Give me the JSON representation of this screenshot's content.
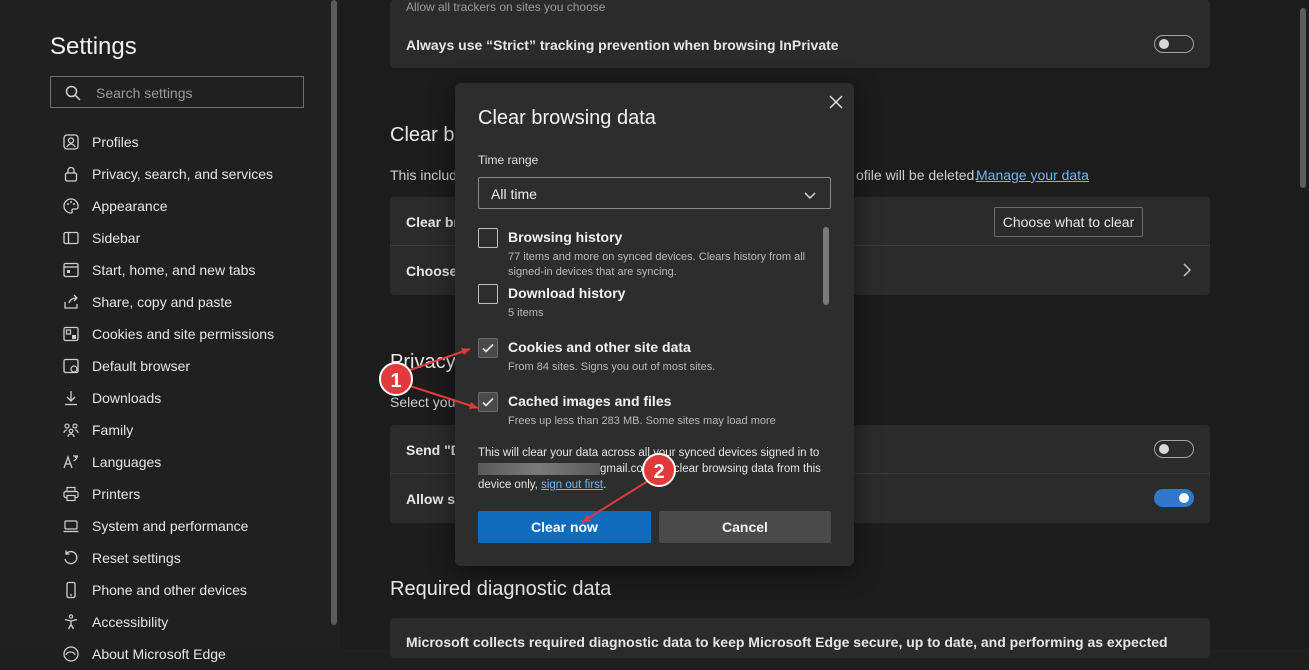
{
  "sidebar": {
    "title": "Settings",
    "search_placeholder": "Search settings",
    "items": [
      {
        "label": "Profiles",
        "icon": "profile-icon"
      },
      {
        "label": "Privacy, search, and services",
        "icon": "lock-icon"
      },
      {
        "label": "Appearance",
        "icon": "palette-icon"
      },
      {
        "label": "Sidebar",
        "icon": "sidebar-icon"
      },
      {
        "label": "Start, home, and new tabs",
        "icon": "home-tab-icon"
      },
      {
        "label": "Share, copy and paste",
        "icon": "share-icon"
      },
      {
        "label": "Cookies and site permissions",
        "icon": "cookie-icon"
      },
      {
        "label": "Default browser",
        "icon": "browser-icon"
      },
      {
        "label": "Downloads",
        "icon": "download-icon"
      },
      {
        "label": "Family",
        "icon": "family-icon"
      },
      {
        "label": "Languages",
        "icon": "languages-icon"
      },
      {
        "label": "Printers",
        "icon": "printer-icon"
      },
      {
        "label": "System and performance",
        "icon": "laptop-icon"
      },
      {
        "label": "Reset settings",
        "icon": "reset-icon"
      },
      {
        "label": "Phone and other devices",
        "icon": "phone-icon"
      },
      {
        "label": "Accessibility",
        "icon": "accessibility-icon"
      },
      {
        "label": "About Microsoft Edge",
        "icon": "edge-icon"
      }
    ]
  },
  "main": {
    "top_card": {
      "subtext": "Allow all trackers on sites you choose",
      "inprivate_label": "Always use “Strict” tracking prevention when browsing InPrivate",
      "inprivate_toggle": "off"
    },
    "clear_section": {
      "heading": "Clear b",
      "desc_left": "This includ",
      "desc_right": "ofile will be deleted.",
      "manage_link": "Manage your data",
      "row1_label": "Clear br",
      "choose_button": "Choose what to clear",
      "row2_label": "Choose"
    },
    "privacy_section": {
      "heading": "Privacy",
      "select_text": "Select you",
      "row1_label": "Send \"D",
      "row1_toggle": "off",
      "row2_label": "Allow si",
      "row2_toggle": "on"
    },
    "diagnostic": {
      "heading": "Required diagnostic data",
      "text": "Microsoft collects required diagnostic data to keep Microsoft Edge secure, up to date, and performing as expected"
    }
  },
  "dialog": {
    "title": "Clear browsing data",
    "time_range_label": "Time range",
    "time_range_value": "All time",
    "options": [
      {
        "title": "Browsing history",
        "desc": "77 items and more on synced devices. Clears history from all signed-in devices that are syncing.",
        "checked": false
      },
      {
        "title": "Download history",
        "desc": "5 items",
        "checked": false
      },
      {
        "title": "Cookies and other site data",
        "desc": "From 84 sites. Signs you out of most sites.",
        "checked": true
      },
      {
        "title": "Cached images and files",
        "desc": "Frees up less than 283 MB. Some sites may load more",
        "checked": true
      }
    ],
    "note_part1": "This will clear your data across all your synced devices signed in to",
    "note_email_suffix": "gmail.com. To clear browsing data from this",
    "note_part2": "device only,",
    "note_link": "sign out first",
    "note_end": ".",
    "primary_button": "Clear now",
    "secondary_button": "Cancel"
  },
  "annotations": {
    "marker1": "1",
    "marker2": "2",
    "color": "#e03a3a"
  }
}
